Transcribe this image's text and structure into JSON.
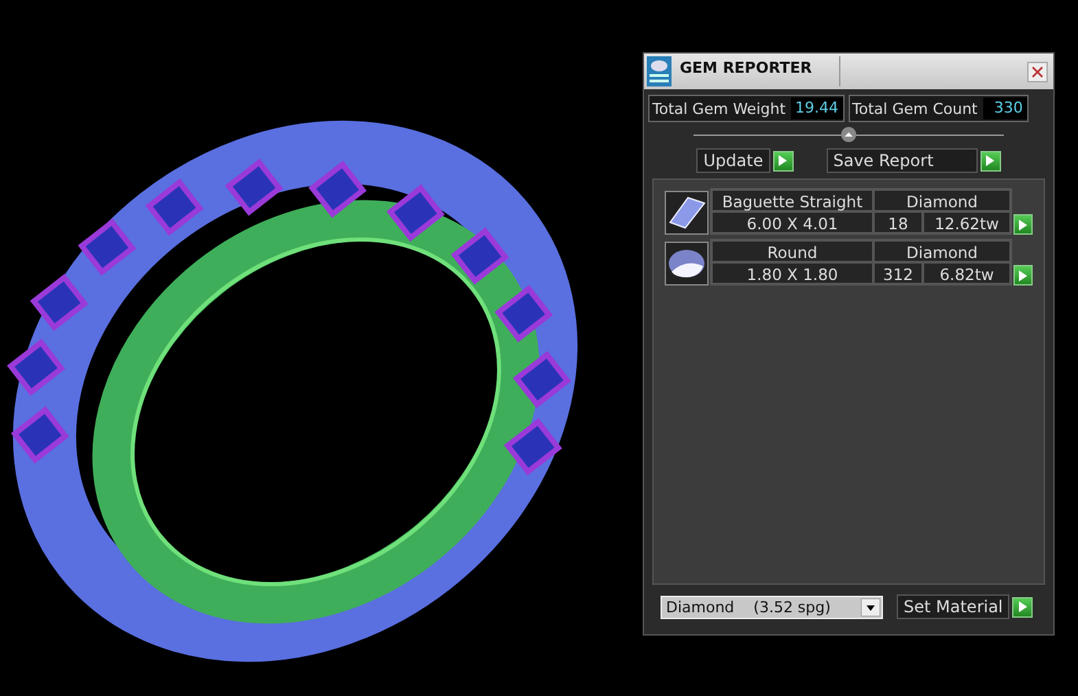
{
  "window": {
    "title": "GEM REPORTER"
  },
  "stats": [
    {
      "label": "Total Gem Weight",
      "value": "19.44"
    },
    {
      "label": "Total Gem Count",
      "value": "330"
    }
  ],
  "actions": [
    "Update",
    "Save Report"
  ],
  "gems": [
    {
      "kind": "baguette",
      "shape": "Baguette Straight",
      "material": "Diamond",
      "size": "6.00 X 4.01",
      "count": "18",
      "weight": "12.62tw"
    },
    {
      "kind": "round",
      "shape": "Round",
      "material": "Diamond",
      "size": "1.80 X 1.80",
      "count": "312",
      "weight": "6.82tw"
    }
  ],
  "material_select": {
    "value": "Diamond    (3.52 spg)"
  },
  "set_material": "Set Material"
}
